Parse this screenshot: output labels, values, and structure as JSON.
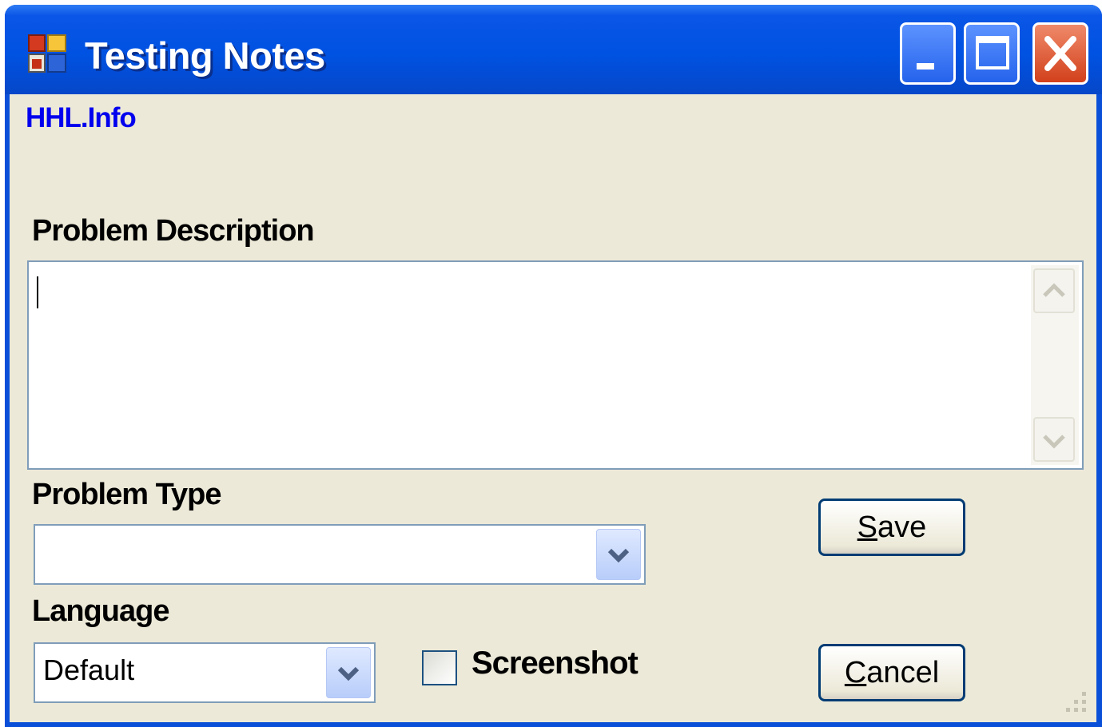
{
  "window": {
    "title": "Testing Notes"
  },
  "titlebar_buttons": {
    "minimize": "minimize-icon",
    "maximize": "maximize-icon",
    "close": "close-icon"
  },
  "info_label": "HHL.Info",
  "problem_description": {
    "label": "Problem Description",
    "value": ""
  },
  "problem_type": {
    "label": "Problem Type",
    "value": ""
  },
  "language": {
    "label": "Language",
    "value": "Default"
  },
  "screenshot": {
    "label": "Screenshot",
    "checked": false
  },
  "buttons": {
    "save": {
      "mnemonic": "S",
      "rest": "ave"
    },
    "cancel": {
      "mnemonic": "C",
      "rest": "ancel"
    }
  },
  "colors": {
    "titlebar": "#0052e2",
    "client": "#ece9d8",
    "info_text": "#0000ee",
    "close_button": "#d2401b"
  }
}
